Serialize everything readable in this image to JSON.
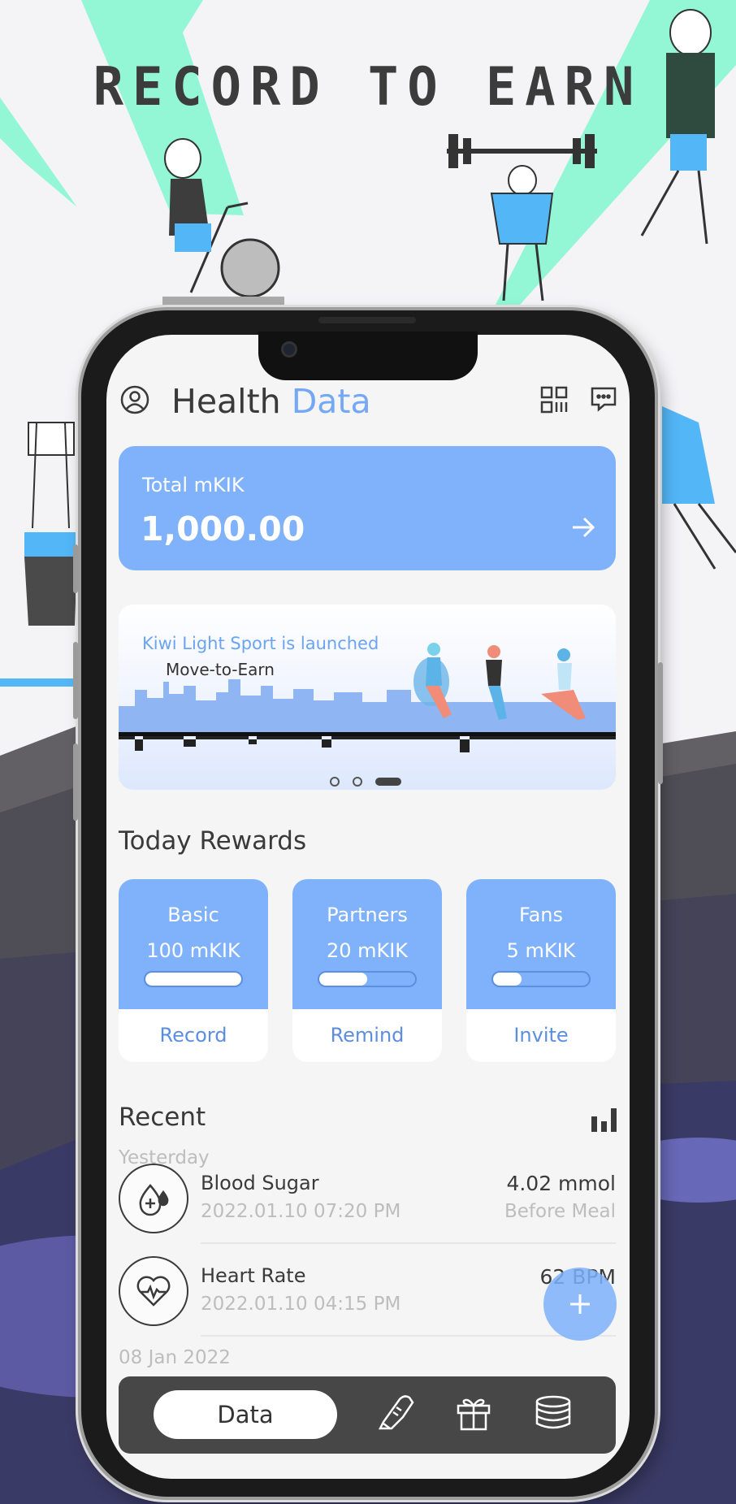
{
  "promo": {
    "headline": "RECORD TO EARN"
  },
  "header": {
    "title_main": "Health",
    "title_accent": "Data",
    "profile_icon": "user-circle-icon",
    "qr_icon": "qr-code-icon",
    "message_icon": "chat-bubble-icon"
  },
  "balance": {
    "label": "Total mKIK",
    "value": "1,000.00",
    "arrow_icon": "arrow-right-icon"
  },
  "banner": {
    "line1": "Kiwi Light Sport is launched",
    "line2": "Move-to-Earn",
    "slide_count": 3,
    "active_slide": 3
  },
  "rewards": {
    "title": "Today Rewards",
    "cards": [
      {
        "name": "Basic",
        "amount": "100 mKIK",
        "progress": 1.0,
        "action": "Record"
      },
      {
        "name": "Partners",
        "amount": "20 mKIK",
        "progress": 0.5,
        "action": "Remind"
      },
      {
        "name": "Fans",
        "amount": "5 mKIK",
        "progress": 0.3,
        "action": "Invite"
      }
    ]
  },
  "recent": {
    "title": "Recent",
    "chart_icon": "bar-chart-icon",
    "groups": [
      {
        "day": "Yesterday",
        "items": [
          {
            "icon": "blood-drop-plus-icon",
            "name": "Blood Sugar",
            "time": "2022.01.10 07:20 PM",
            "value": "4.02 mmol",
            "sub": "Before Meal"
          },
          {
            "icon": "heart-pulse-icon",
            "name": "Heart Rate",
            "time": "2022.01.10 04:15 PM",
            "value": "62 BPM",
            "sub": ""
          }
        ]
      },
      {
        "day": "08 Jan 2022",
        "items": []
      }
    ],
    "fab_icon": "plus-icon"
  },
  "tabbar": {
    "active_label": "Data",
    "icons": [
      "sneaker-icon",
      "gift-icon",
      "coin-stack-icon"
    ]
  },
  "colors": {
    "accent": "#74a8f7",
    "card_blue": "#7fb2fa",
    "link_blue": "#5c8ee0",
    "background": "#f5f5f6",
    "tabbar": "#474747"
  }
}
